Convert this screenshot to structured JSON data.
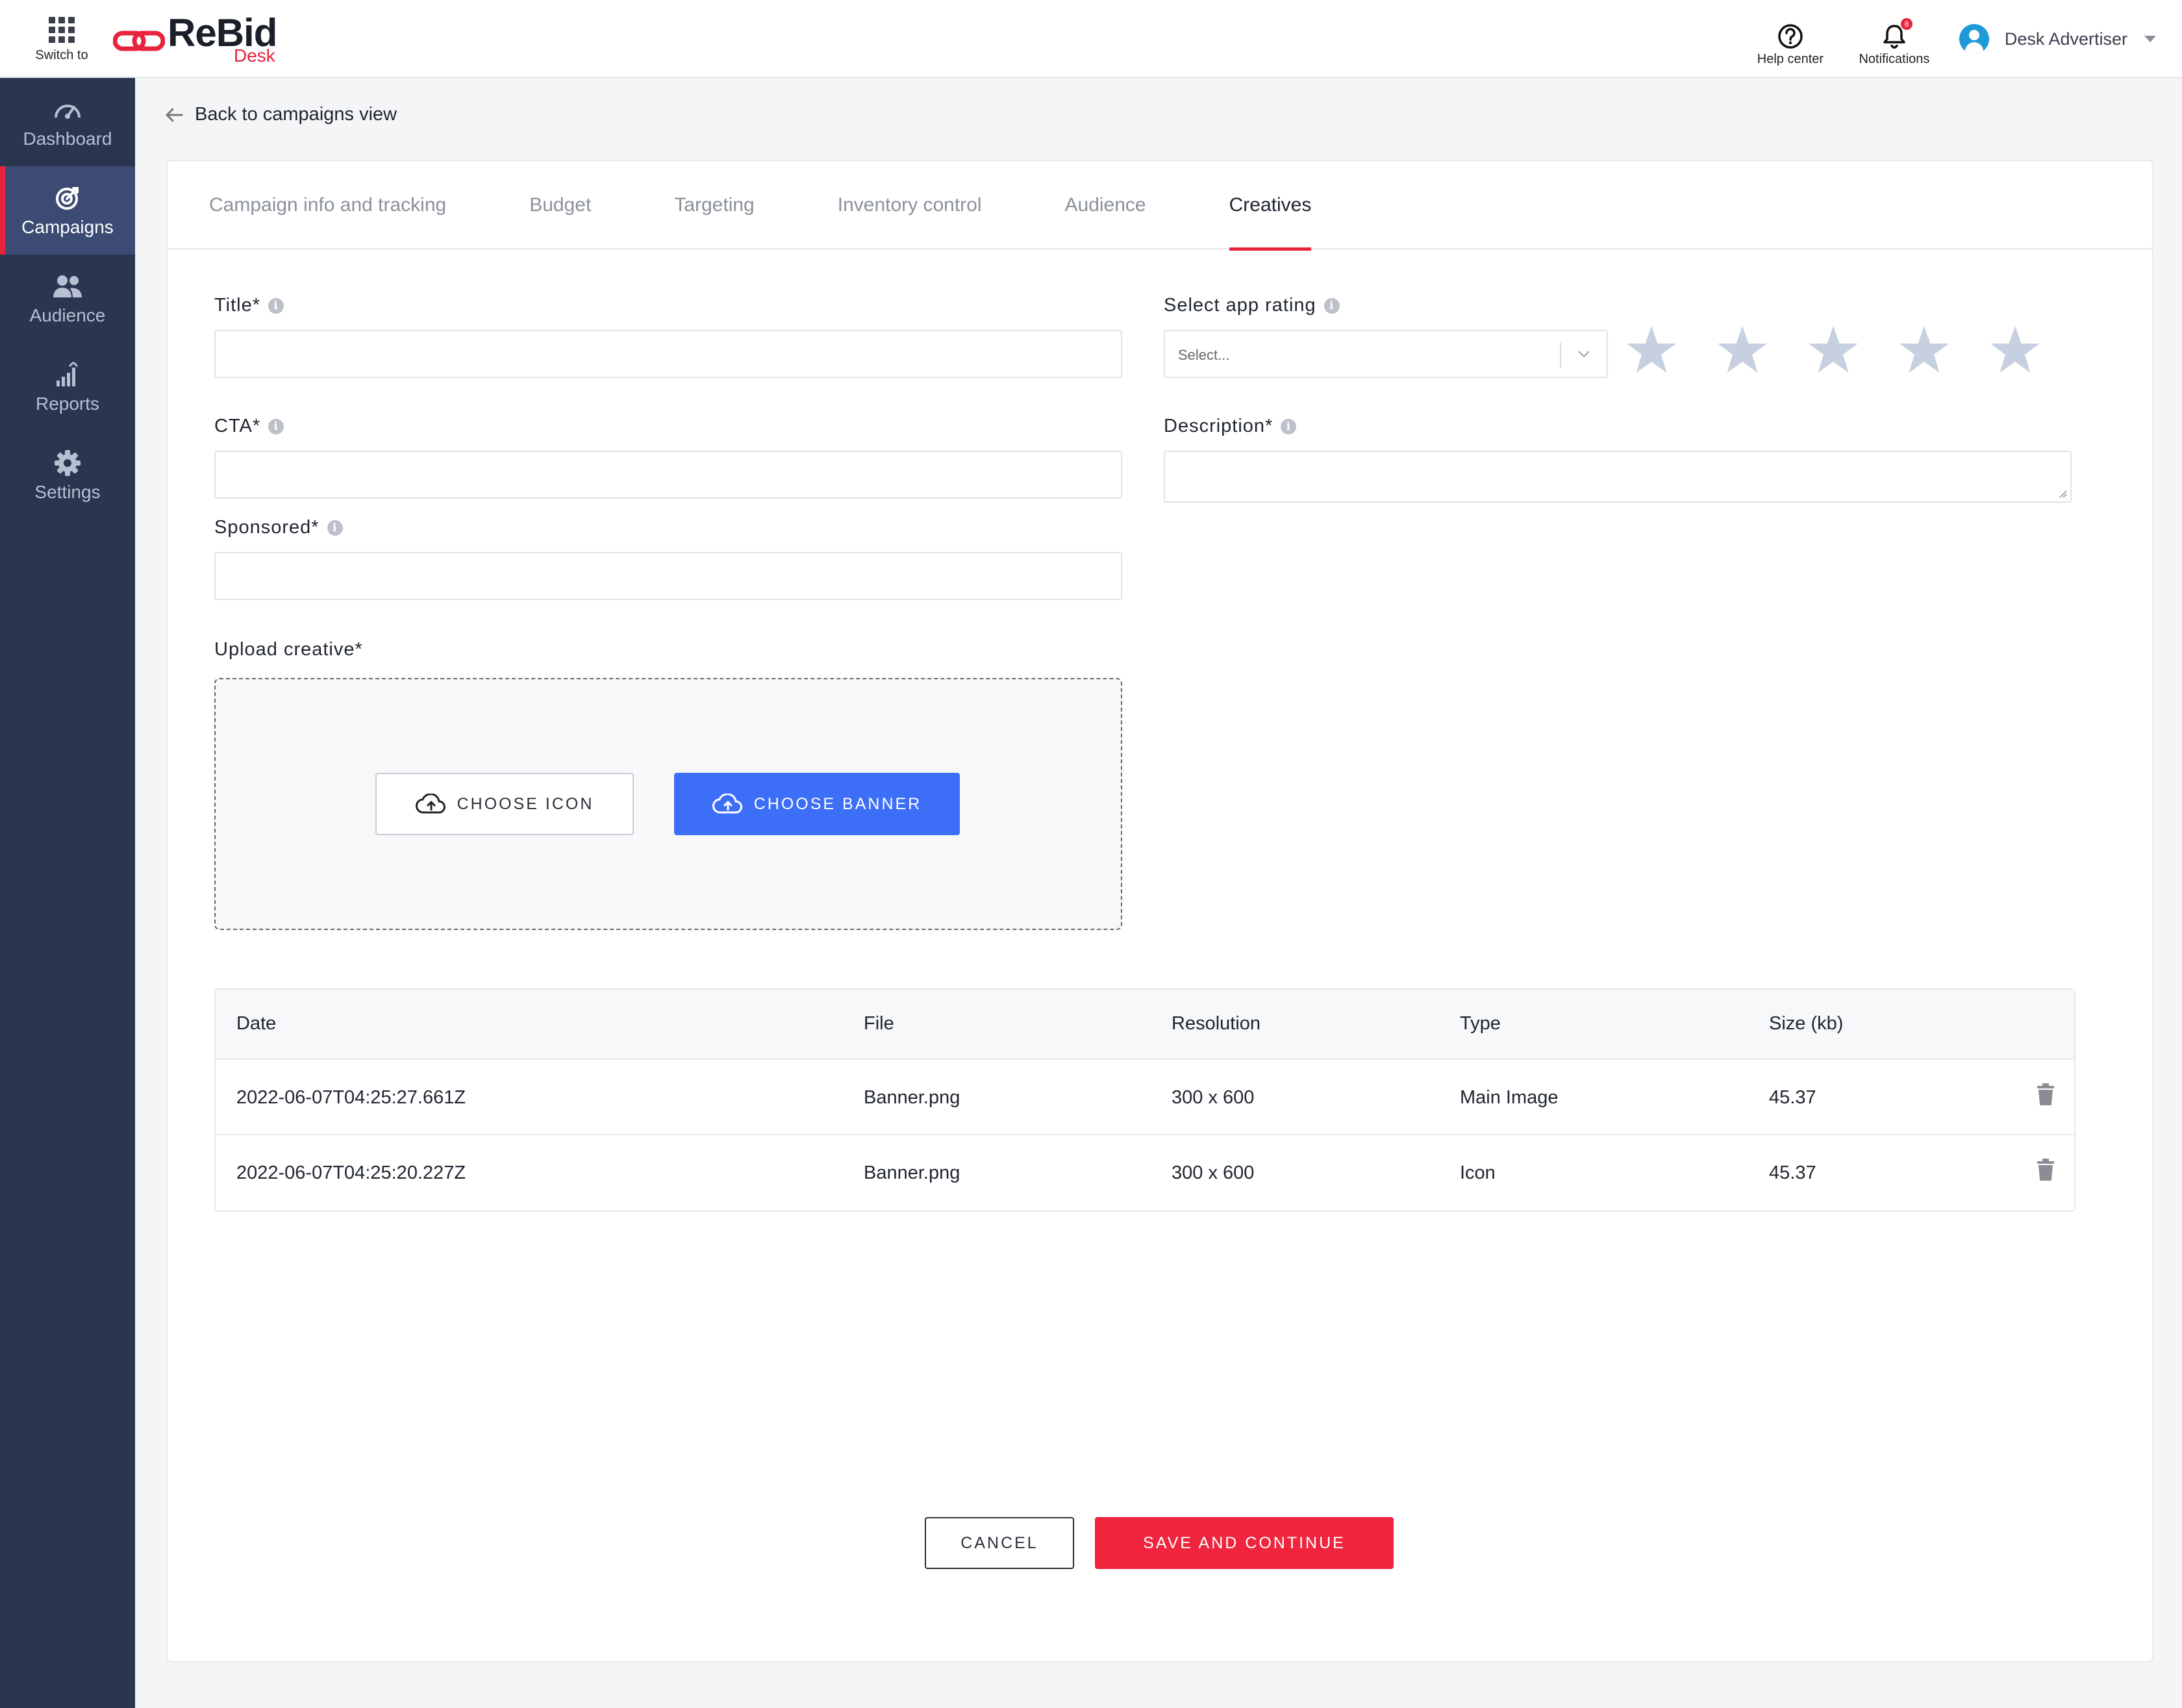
{
  "header": {
    "switch_label": "Switch to",
    "logo_text": "ReBid",
    "logo_sub": "Desk",
    "help_label": "Help center",
    "notifications_label": "Notifications",
    "notification_count": "8",
    "user_name": "Desk Advertiser"
  },
  "sidebar": {
    "items": [
      {
        "label": "Dashboard",
        "icon": "gauge-icon"
      },
      {
        "label": "Campaigns",
        "icon": "target-icon",
        "active": true
      },
      {
        "label": "Audience",
        "icon": "people-icon"
      },
      {
        "label": "Reports",
        "icon": "bar-chart-icon"
      },
      {
        "label": "Settings",
        "icon": "gear-icon"
      }
    ]
  },
  "back_link": "Back to campaigns view",
  "tabs": [
    {
      "label": "Campaign info and tracking"
    },
    {
      "label": "Budget"
    },
    {
      "label": "Targeting"
    },
    {
      "label": "Inventory control"
    },
    {
      "label": "Audience"
    },
    {
      "label": "Creatives",
      "active": true
    }
  ],
  "form": {
    "title_label": "Title*",
    "title_value": "",
    "app_rating_label": "Select app rating",
    "app_rating_placeholder": "Select...",
    "stars_total": 5,
    "stars_filled": 0,
    "cta_label": "CTA*",
    "cta_value": "",
    "description_label": "Description*",
    "description_value": "",
    "sponsored_label": "Sponsored*",
    "sponsored_value": "",
    "upload_label": "Upload creative*",
    "choose_icon": "CHOOSE ICON",
    "choose_banner": "CHOOSE BANNER"
  },
  "table": {
    "columns": [
      "Date",
      "File",
      "Resolution",
      "Type",
      "Size (kb)"
    ],
    "rows": [
      {
        "date": "2022-06-07T04:25:27.661Z",
        "file": "Banner.png",
        "resolution": "300 x 600",
        "type": "Main Image",
        "size": "45.37"
      },
      {
        "date": "2022-06-07T04:25:20.227Z",
        "file": "Banner.png",
        "resolution": "300 x 600",
        "type": "Icon",
        "size": "45.37"
      }
    ]
  },
  "actions": {
    "cancel": "CANCEL",
    "save": "SAVE AND CONTINUE"
  },
  "colors": {
    "accent_red": "#e8233d",
    "sidebar_bg": "#2b3550",
    "primary_blue": "#3d6ef8",
    "star_empty": "#c6d0e0"
  }
}
